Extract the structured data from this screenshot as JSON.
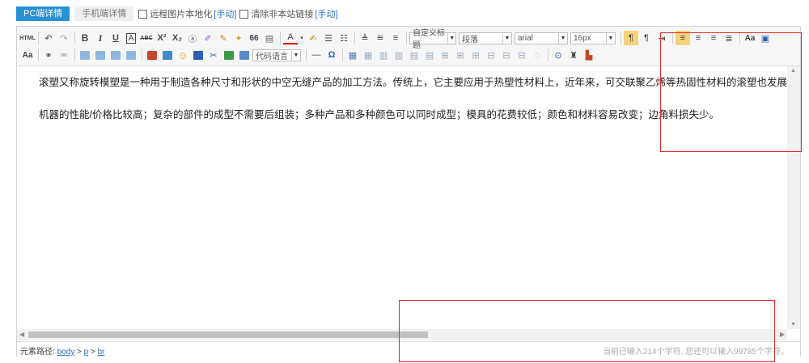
{
  "tabs": {
    "pc": "PC端详情",
    "mobile": "手机端详情"
  },
  "options": {
    "remote_img": "远程图片本地化",
    "remote_img_link": "[手动]",
    "clear_links": "清除非本站链接",
    "clear_links_link": "[手动]"
  },
  "toolbar": {
    "html_label": "HTML",
    "bold": "B",
    "italic": "I",
    "underline": "U",
    "border_a": "A",
    "strike": "ABC",
    "sup": "X²",
    "sub": "X₂",
    "quote": "66",
    "font_color": "A",
    "custom_heading": "自定义标题",
    "paragraph": "段落",
    "font_family": "arial",
    "font_size": "16px",
    "code_lang": "代码语言",
    "hr": "—",
    "omega": "Ω",
    "case_label": "Aa"
  },
  "content": {
    "paragraph_1": "滚塑又称旋转模塑是一种用于制造各种尺寸和形状的中空无缝产品的加工方法。传统上，它主要应用于热塑性材料上，近年来，可交联聚乙烯等热固性材料的滚塑也发展很快",
    "paragraph_2": "机器的性能/价格比较高；复杂的部件的成型不需要后组装；多种产品和多种颜色可以同时成型；模具的花费较低；颜色和材料容易改变；边角料损失少。"
  },
  "statusbar": {
    "path_label": "元素路径:",
    "path_body": "body",
    "path_sep1": ">",
    "path_p": "p",
    "path_sep2": ">",
    "path_br": "br",
    "char_count": "当前已输入214个字符, 您还可以输入99785个字符。"
  },
  "colors": {
    "accent": "#2b91d5",
    "highlight_box": "#e02b2b"
  }
}
